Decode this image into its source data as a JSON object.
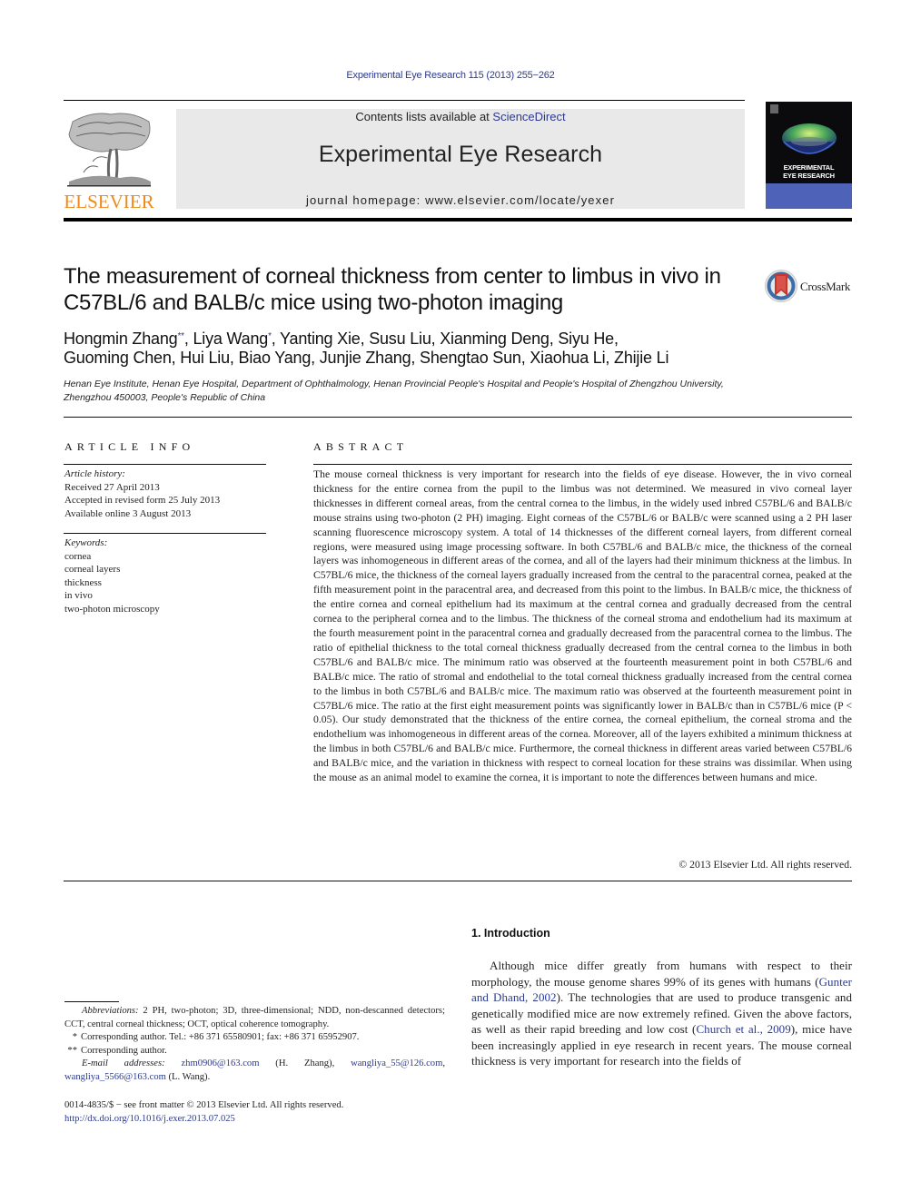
{
  "header": {
    "journal_reference": "Experimental Eye Research 115 (2013) 255−262",
    "contents_prefix": "Contents lists available at ",
    "contents_link": "ScienceDirect",
    "journal_title": "Experimental Eye Research",
    "homepage": "journal homepage: www.elsevier.com/locate/yexer",
    "publisher": "ELSEVIER",
    "cover_title_line1": "EXPERIMENTAL",
    "cover_title_line2": "EYE RESEARCH",
    "crossmark_label": "CrossMark",
    "colors": {
      "link": "#2b3a8f",
      "publisher_orange": "#f08a1c",
      "banner_gray": "#e9e9e9",
      "cover_band": "#4e62b8"
    }
  },
  "article": {
    "title": "The measurement of corneal thickness from center to limbus in vivo in C57BL/6 and BALB/c mice using two-photon imaging",
    "authors": [
      {
        "name": "Hongmin Zhang",
        "mark": "**"
      },
      {
        "name": "Liya Wang",
        "mark": "*"
      },
      {
        "name": "Yanting Xie",
        "mark": ""
      },
      {
        "name": "Susu Liu",
        "mark": ""
      },
      {
        "name": "Xianming Deng",
        "mark": ""
      },
      {
        "name": "Siyu He",
        "mark": ""
      },
      {
        "name": "Guoming Chen",
        "mark": ""
      },
      {
        "name": "Hui Liu",
        "mark": ""
      },
      {
        "name": "Biao Yang",
        "mark": ""
      },
      {
        "name": "Junjie Zhang",
        "mark": ""
      },
      {
        "name": "Shengtao Sun",
        "mark": ""
      },
      {
        "name": "Xiaohua Li",
        "mark": ""
      },
      {
        "name": "Zhijie Li",
        "mark": ""
      }
    ],
    "affiliation": "Henan Eye Institute, Henan Eye Hospital, Department of Ophthalmology, Henan Provincial People's Hospital and People's Hospital of Zhengzhou University, Zhengzhou 450003, People's Republic of China"
  },
  "article_info": {
    "heading": "ARTICLE INFO",
    "history_label": "Article history:",
    "history": [
      "Received 27 April 2013",
      "Accepted in revised form 25 July 2013",
      "Available online 3 August 2013"
    ],
    "keywords_label": "Keywords:",
    "keywords": [
      "cornea",
      "corneal layers",
      "thickness",
      "in vivo",
      "two-photon microscopy"
    ]
  },
  "abstract": {
    "heading": "ABSTRACT",
    "text": "The mouse corneal thickness is very important for research into the fields of eye disease. However, the in vivo corneal thickness for the entire cornea from the pupil to the limbus was not determined. We measured in vivo corneal layer thicknesses in different corneal areas, from the central cornea to the limbus, in the widely used inbred C57BL/6 and BALB/c mouse strains using two-photon (2 PH) imaging. Eight corneas of the C57BL/6 or BALB/c were scanned using a 2 PH laser scanning fluorescence microscopy system. A total of 14 thicknesses of the different corneal layers, from different corneal regions, were measured using image processing software. In both C57BL/6 and BALB/c mice, the thickness of the corneal layers was inhomogeneous in different areas of the cornea, and all of the layers had their minimum thickness at the limbus. In C57BL/6 mice, the thickness of the corneal layers gradually increased from the central to the paracentral cornea, peaked at the fifth measurement point in the paracentral area, and decreased from this point to the limbus. In BALB/c mice, the thickness of the entire cornea and corneal epithelium had its maximum at the central cornea and gradually decreased from the central cornea to the peripheral cornea and to the limbus. The thickness of the corneal stroma and endothelium had its maximum at the fourth measurement point in the paracentral cornea and gradually decreased from the paracentral cornea to the limbus. The ratio of epithelial thickness to the total corneal thickness gradually decreased from the central cornea to the limbus in both C57BL/6 and BALB/c mice. The minimum ratio was observed at the fourteenth measurement point in both C57BL/6 and BALB/c mice. The ratio of stromal and endothelial to the total corneal thickness gradually increased from the central cornea to the limbus in both C57BL/6 and BALB/c mice. The maximum ratio was observed at the fourteenth measurement point in C57BL/6 mice. The ratio at the first eight measurement points was significantly lower in BALB/c than in C57BL/6 mice (P < 0.05). Our study demonstrated that the thickness of the entire cornea, the corneal epithelium, the corneal stroma and the endothelium was inhomogeneous in different areas of the cornea. Moreover, all of the layers exhibited a minimum thickness at the limbus in both C57BL/6 and BALB/c mice. Furthermore, the corneal thickness in different areas varied between C57BL/6 and BALB/c mice, and the variation in thickness with respect to corneal location for these strains was dissimilar. When using the mouse as an animal model to examine the cornea, it is important to note the differences between humans and mice.",
    "copyright": "© 2013 Elsevier Ltd. All rights reserved."
  },
  "introduction": {
    "heading": "1.  Introduction",
    "seg1": "Although mice differ greatly from humans with respect to their morphology, the mouse genome shares 99% of its genes with humans (",
    "ref1": "Gunter and Dhand, 2002",
    "seg2": "). The technologies that are used to produce transgenic and genetically modified mice are now extremely refined. Given the above factors, as well as their rapid breeding and low cost (",
    "ref2": "Church et al., 2009",
    "seg3": "), mice have been increasingly applied in eye research in recent years. The mouse corneal thickness is very important for research into the fields of"
  },
  "footnotes": {
    "abbrev_label": "Abbreviations:",
    "abbrev_text": " 2 PH, two-photon; 3D, three-dimensional; NDD, non-descanned detectors; CCT, central corneal thickness; OCT, optical coherence tomography.",
    "corr1_mark": "*",
    "corr1_text": "Corresponding author. Tel.: +86 371 65580901; fax: +86 371 65952907.",
    "corr2_mark": "**",
    "corr2_text": "Corresponding author.",
    "email_label": "E-mail addresses:",
    "email1": "zhm0906@163.com",
    "email1_owner": " (H. Zhang), ",
    "email2": "wangliya_55@126.com",
    "email2_sep": ", ",
    "email3": "wangliya_5566@163.com",
    "email3_owner": " (L. Wang).",
    "front_matter": "0014-4835/$ − see front matter © 2013 Elsevier Ltd. All rights reserved.",
    "doi": "http://dx.doi.org/10.1016/j.exer.2013.07.025"
  }
}
